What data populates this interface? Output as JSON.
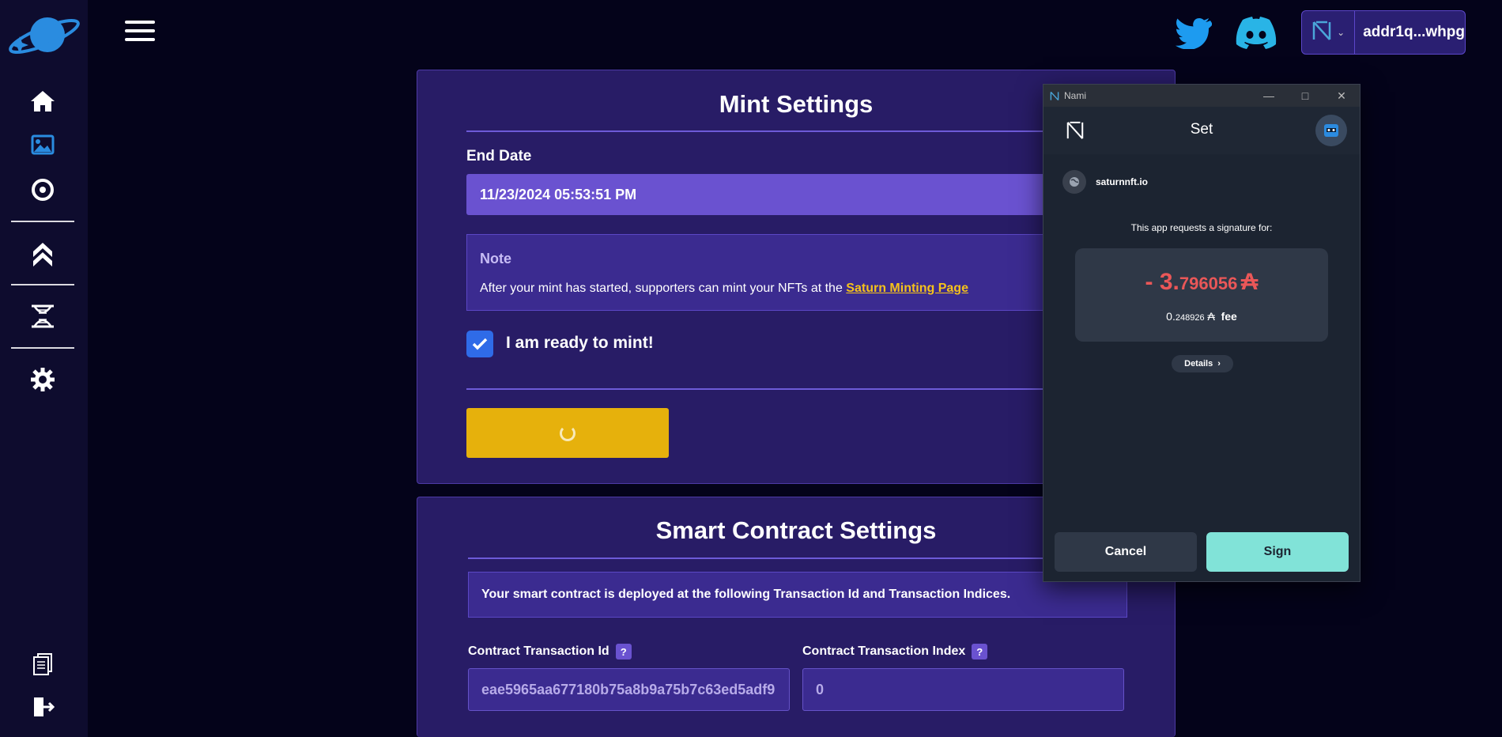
{
  "colors": {
    "accent": "#6a52d0",
    "card": "#281c66",
    "mint_button": "#e6b10c",
    "sign_button": "#81e3d8",
    "amount": "#ea5758"
  },
  "sidebar": {
    "icons": [
      "home-icon",
      "image-icon",
      "compass-icon",
      "chevron-up-icon",
      "hourglass-icon",
      "gear-icon",
      "documents-icon",
      "logout-icon"
    ]
  },
  "topbar": {
    "wallet_address": "addr1q...whpg"
  },
  "mint_settings": {
    "title": "Mint Settings",
    "end_date_label": "End Date",
    "end_date_value": "11/23/2024 05:53:51 PM",
    "note_title": "Note",
    "note_text": "After your mint has started, supporters can mint your NFTs at the ",
    "note_link": "Saturn Minting Page",
    "ready_checkbox_checked": true,
    "ready_label": "I am ready to mint!"
  },
  "smart_contract": {
    "title": "Smart Contract Settings",
    "info": "Your smart contract is deployed at the following Transaction Id and Transaction Indices.",
    "tx_id_label": "Contract Transaction Id",
    "tx_id_value": "eae5965aa677180b75a8b9a75b7c63ed5adf9",
    "tx_index_label": "Contract Transaction Index",
    "tx_index_value": "0",
    "help_symbol": "?"
  },
  "nami": {
    "window_title": "Nami",
    "header": "Set",
    "site": "saturnnft.io",
    "request_text": "This app requests a signature for:",
    "amount_prefix": "- 3.",
    "amount_decimals": "796056",
    "currency_symbol": "₳",
    "fee_prefix": "0.",
    "fee_decimals": "248926",
    "fee_label": "fee",
    "details_label": "Details",
    "cancel_label": "Cancel",
    "sign_label": "Sign"
  }
}
